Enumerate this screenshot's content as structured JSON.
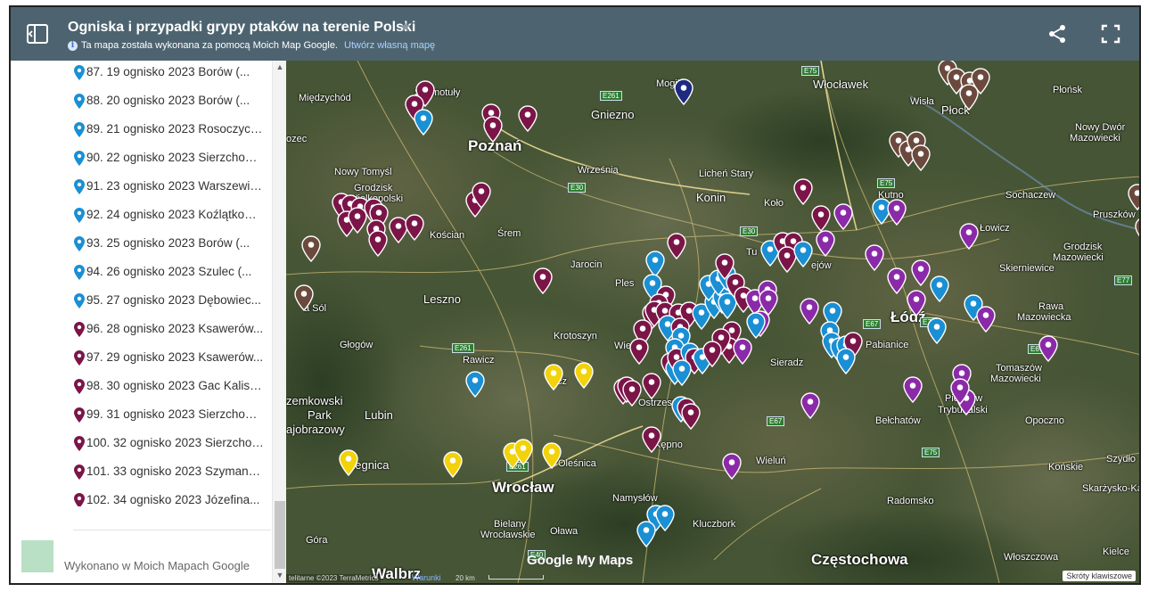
{
  "header": {
    "title": "Ogniska i przypadki grypy ptaków na terenie Polski",
    "subtitle": "Ta mapa została wykonana za pomocą Moich Map Google.",
    "create_link": "Utwórz własną mapę"
  },
  "sidebar": {
    "items": [
      {
        "label": "87. 19 ognisko 2023 Borów (...",
        "color": "#1a8fd3"
      },
      {
        "label": "88. 20 ognisko 2023 Borów (...",
        "color": "#1a8fd3"
      },
      {
        "label": "89. 21 ognisko 2023 Rosoczyce...",
        "color": "#1a8fd3"
      },
      {
        "label": "90. 22 ognisko 2023 Sierzchowo...",
        "color": "#1a8fd3"
      },
      {
        "label": "91. 23 ognisko 2023 Warszewice...",
        "color": "#1a8fd3"
      },
      {
        "label": "92. 24 ognisko 2023 Koźlątkowo...",
        "color": "#1a8fd3"
      },
      {
        "label": "93. 25 ognisko 2023 Borów (...",
        "color": "#1a8fd3"
      },
      {
        "label": "94. 26 ognisko 2023 Szulec (...",
        "color": "#1a8fd3"
      },
      {
        "label": "95. 27 ognisko 2023 Dębowiec...",
        "color": "#1a8fd3"
      },
      {
        "label": "96. 28 ognisko 2023 Ksawerów...",
        "color": "#7b1548"
      },
      {
        "label": "97. 29 ognisko 2023 Ksawerów...",
        "color": "#7b1548"
      },
      {
        "label": "98. 30 ognisko 2023 Gac Kaliska...",
        "color": "#7b1548"
      },
      {
        "label": "99. 31 ognisko 2023 Sierzchowo...",
        "color": "#7b1548"
      },
      {
        "label": "100. 32 ognisko 2023 Sierzchowo...",
        "color": "#7b1548"
      },
      {
        "label": "101. 33 ognisko 2023 Szymanowice...",
        "color": "#7b1548"
      },
      {
        "label": "102. 34 ognisko 2023 Józefina...",
        "color": "#7b1548"
      }
    ],
    "footer": "Wykonano w Moich Mapach Google"
  },
  "map": {
    "places": {
      "mogilno": "Mogilno",
      "wloclawek": "Włocławek",
      "plonsk": "Płońsk",
      "plock": "Płock",
      "wisla": "Wisła",
      "nowy_dwor": "Nowy Dwór",
      "mazowiecki": "Mazowiecki",
      "miedzychod": "Międzychód",
      "szamotuly": "Szamotuły",
      "poznan": "Poznań",
      "gniezno": "Gniezno",
      "nowy_tomysl": "Nowy Tomyśl",
      "grodzisk": "Grodzisk",
      "wielkopolski": "Wielkopolski",
      "wrzesnia": "Września",
      "lichen": "Licheń Stary",
      "konin": "Konin",
      "kolo": "Koło",
      "kutno": "Kutno",
      "sochaczew": "Sochaczew",
      "pruszkow": "Pruszków",
      "lowicz": "Łowicz",
      "grodzisk_maz": "Grodzisk",
      "skierniewice": "Skierniewice",
      "koscian": "Kościan",
      "srem": "Śrem",
      "jarocin": "Jarocin",
      "leszno": "Leszno",
      "kalisz": "Kalisz",
      "lodz": "Łódź",
      "pabianice": "Pabianice",
      "rawa": "Rawa",
      "mazowiecka": "Mazowiecka",
      "glogow": "Głogów",
      "krotoszyn": "Krotoszyn",
      "sieradz": "Sieradz",
      "tomaszow": "Tomaszów",
      "rawicz": "Rawicz",
      "lubin": "Lubin",
      "ostrzeszow": "Ostrzeszów",
      "piotrkow": "Piotrków",
      "trybunalski": "Trybunalski",
      "belchatow": "Bełchatów",
      "opoczno": "Opoczno",
      "legnica": "Legnica",
      "olesnica": "Oleśnica",
      "kepno": "Kępno",
      "wielun": "Wieluń",
      "konskie": "Końskie",
      "szydlowiec": "Szydło",
      "wroclaw": "Wrocław",
      "namyslow": "Namysłów",
      "radomsko": "Radomsko",
      "skarzysko": "Skarżysko-Kam",
      "bielany": "Bielany",
      "wroclawskie": "Wrocławskie",
      "olawa": "Oława",
      "kluczbork": "Kluczbork",
      "wloszczowa": "Włoszczowa",
      "gora": "Góra",
      "czestochowa": "Częstochowa",
      "kielce": "Kielce",
      "park": "Park",
      "zemkowski": "zemkowski",
      "jaborazowy": "ajobrazowy",
      "ozec": "ozec",
      "jewo": "jew",
      "czek": "cz",
      "plesz": "Ples",
      "turek": "Tu",
      "wiel": "Wie",
      "sol": "a Sól",
      "walbrz": "Walbrz",
      "kalis": "Kali",
      "zejow": "ejów",
      "ka": "Ka",
      "ta": "Ta"
    },
    "roads": [
      "E75",
      "E261",
      "E30",
      "E30",
      "E75",
      "E261",
      "E67",
      "E75",
      "E67",
      "E67",
      "E75",
      "E261",
      "E40",
      "E77"
    ],
    "attribution": "telitarne ©2023 TerraMetrics",
    "warning": "Warunki",
    "scale": "20 km",
    "shortcuts": "Skróty klawiszowe",
    "logo": "Google My Maps",
    "colors": {
      "blue": "#1a8fd3",
      "maroon": "#7b1548",
      "purple": "#8b2aa8",
      "brown": "#6b4a3d",
      "yellow": "#f2d20a",
      "navy": "#1c2a80"
    }
  }
}
